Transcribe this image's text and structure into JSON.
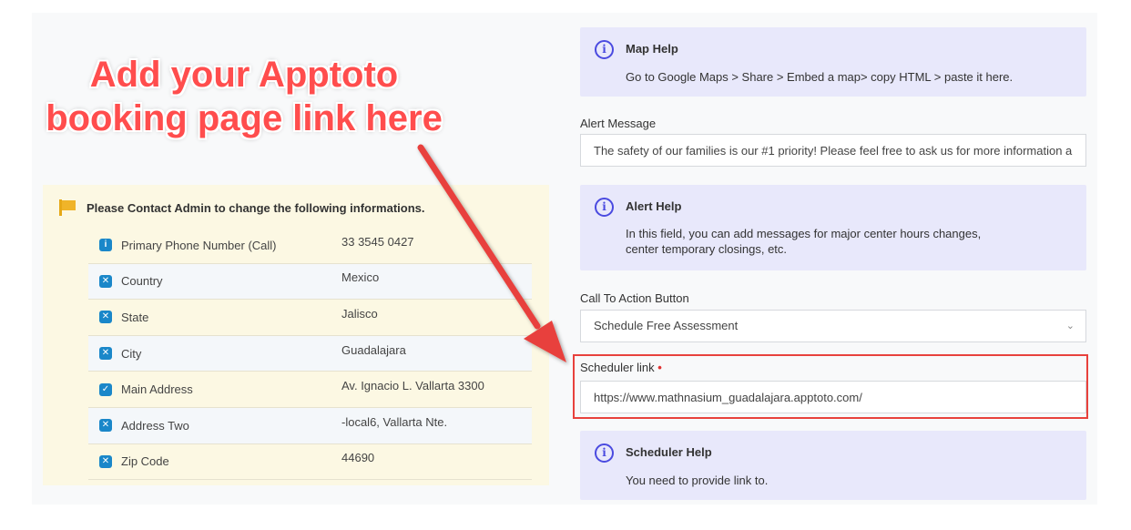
{
  "callout": {
    "line1": "Add your Apptoto",
    "line2": "booking page link here"
  },
  "contact": {
    "title": "Please Contact Admin to change the following informations.",
    "rows": [
      {
        "label": "Primary Phone Number (Call)",
        "value": "33 3545 0427",
        "badge": "i"
      },
      {
        "label": "Country",
        "value": "Mexico",
        "badge": "x"
      },
      {
        "label": "State",
        "value": "Jalisco",
        "badge": "x"
      },
      {
        "label": "City",
        "value": "Guadalajara",
        "badge": "x"
      },
      {
        "label": "Main Address",
        "value": "Av. Ignacio L. Vallarta 3300",
        "badge": "check"
      },
      {
        "label": "Address Two",
        "value": "-local6, Vallarta Nte.",
        "badge": "x"
      },
      {
        "label": "Zip Code",
        "value": "44690",
        "badge": "x"
      }
    ]
  },
  "map_help": {
    "title": "Map Help",
    "text": "Go to Google Maps > Share > Embed a map> copy HTML > paste it here."
  },
  "alert_message": {
    "label": "Alert Message",
    "value": "The safety of our families is our #1 priority! Please feel free to ask us for more information a"
  },
  "alert_help": {
    "title": "Alert Help",
    "text": "In this field, you can add messages for major center hours changes, center temporary closings, etc."
  },
  "cta": {
    "label": "Call To Action Button",
    "value": "Schedule Free Assessment"
  },
  "scheduler": {
    "label": "Scheduler link",
    "required_mark": "•",
    "value": "https://www.mathnasium_guadalajara.apptoto.com/"
  },
  "scheduler_help": {
    "title": "Scheduler Help",
    "text": "You need to provide link to."
  },
  "colors": {
    "accent": "#4a4ae0",
    "annotation": "#e8413c",
    "badge": "#1a87c9"
  }
}
